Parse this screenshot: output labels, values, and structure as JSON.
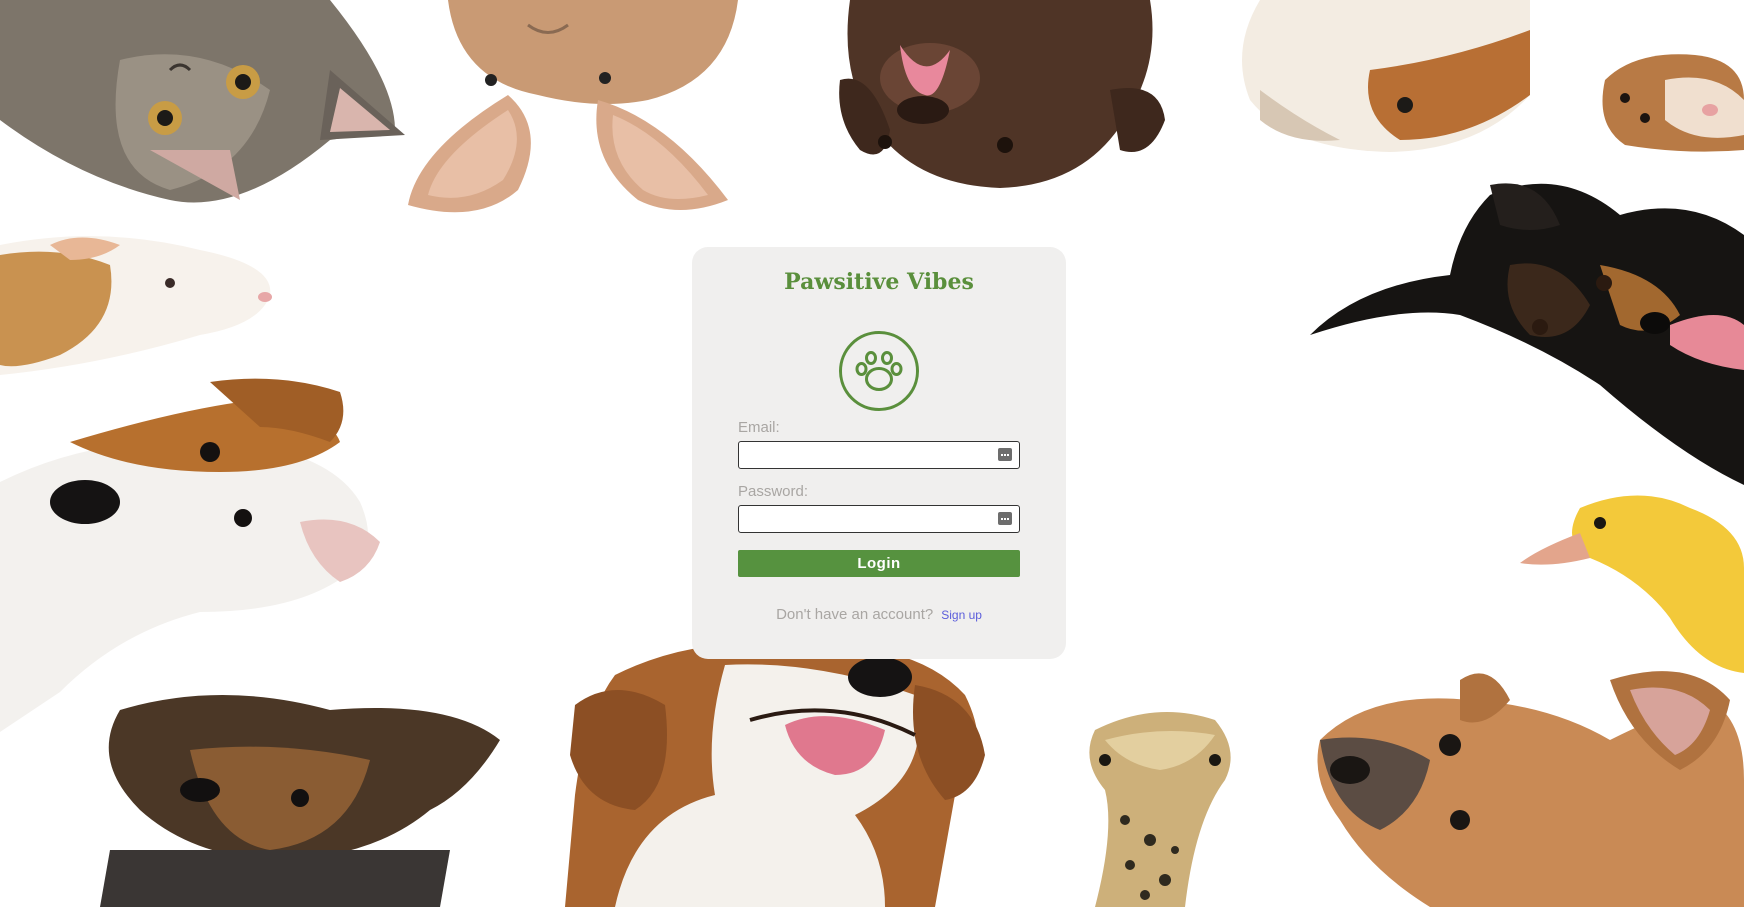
{
  "app": {
    "title": "Pawsitive Vibes",
    "logo_icon": "paw-icon",
    "brand_color": "#5a8f3c"
  },
  "login_form": {
    "email_label": "Email:",
    "email_value": "",
    "password_label": "Password:",
    "password_value": "",
    "field_icon": "password-manager-key-icon",
    "login_button_label": "Login",
    "login_button_color": "#56923f"
  },
  "signup": {
    "prompt": "Don't have an account?",
    "link_label": "Sign up",
    "link_color": "#5b5ddb"
  },
  "background": {
    "decorations": [
      "cat",
      "rabbit",
      "chocolate-labrador-puppy",
      "guinea-pig",
      "hamster",
      "guinea-pig-white",
      "black-tan-dog",
      "jack-russell-terrier",
      "yellow-duckling",
      "yorkshire-terrier",
      "beagle",
      "lizard",
      "french-bulldog"
    ]
  }
}
